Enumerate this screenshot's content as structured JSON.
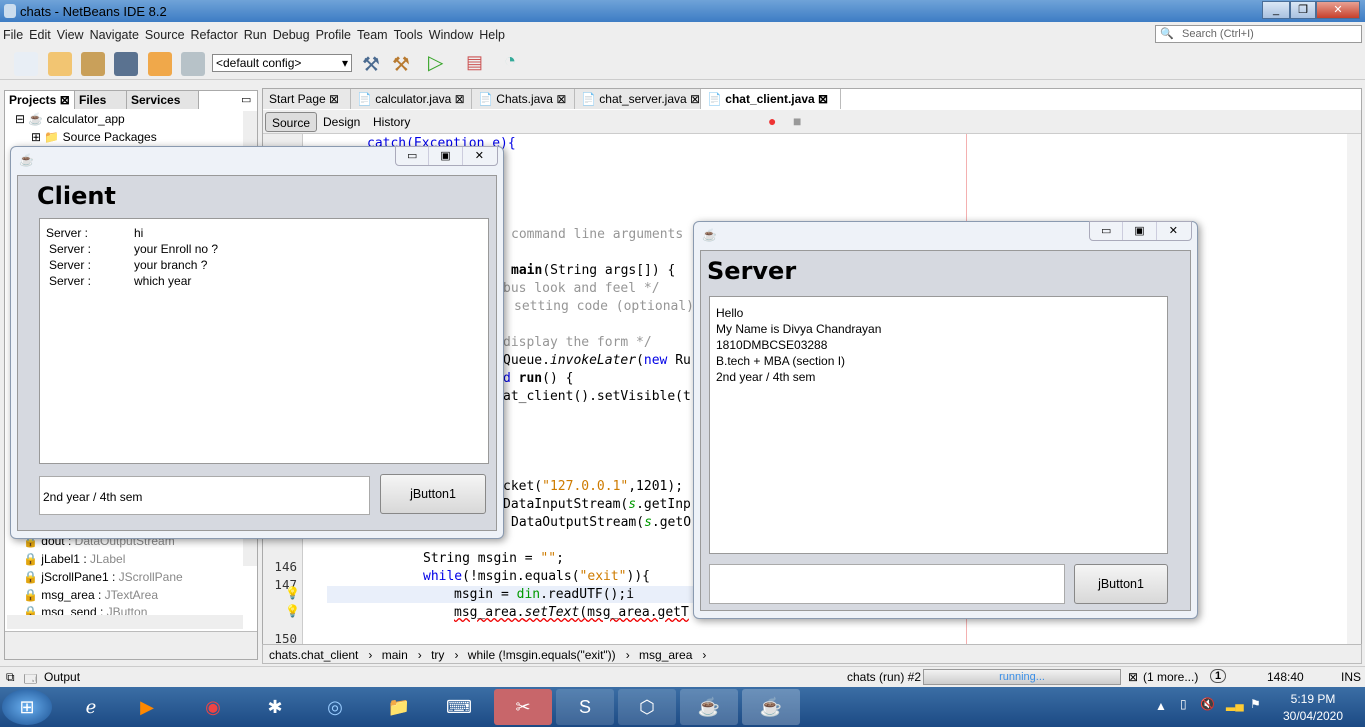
{
  "window": {
    "title": "chats - NetBeans IDE 8.2",
    "controls": [
      "_",
      "❐",
      "✕"
    ]
  },
  "menu": [
    "File",
    "Edit",
    "View",
    "Navigate",
    "Source",
    "Refactor",
    "Run",
    "Debug",
    "Profile",
    "Team",
    "Tools",
    "Window",
    "Help"
  ],
  "search": {
    "placeholder": "Search (Ctrl+I)"
  },
  "toolbar": {
    "config": "<default config>"
  },
  "left_panel": {
    "tabs": [
      "Projects",
      "Files",
      "Services"
    ],
    "tree": [
      {
        "name": "calculator_app",
        "type": ""
      },
      {
        "name": "Source Packages",
        "type": ""
      },
      {
        "name": "dout",
        "type": "DataOutputStream"
      },
      {
        "name": "jLabel1",
        "type": "JLabel"
      },
      {
        "name": "jScrollPane1",
        "type": "JScrollPane"
      },
      {
        "name": "msg_area",
        "type": "JTextArea"
      },
      {
        "name": "msg_send",
        "type": "JButton"
      }
    ]
  },
  "editor": {
    "tabs": [
      "Start Page",
      "calculator.java",
      "Chats.java",
      "chat_server.java",
      "chat_client.java"
    ],
    "view_tabs": [
      "Source",
      "Design",
      "History"
    ],
    "line_numbers": [
      "146",
      "147",
      "150"
    ],
    "code": {
      "l1": "catch(Exception e){",
      "l2": "command line arguments",
      "l3a": "main",
      "l3b": "(String args[]) {",
      "l4": "bus look and feel */",
      "l5": "setting code (optional)",
      "l6": "display the form */",
      "l7a": "Queue.",
      "l7b": "invokeLater",
      "l7c": "(",
      "l7d": "new",
      "l7e": " Ru",
      "l8a": "d ",
      "l8b": "run",
      "l8c": "() {",
      "l9": "at_client().setVisible(t",
      "l10a": "cket(",
      "l10b": "\"127.0.0.1\"",
      "l10c": ",1201);",
      "l11a": "DataInputStream(",
      "l11b": "s",
      "l11c": ".getInp",
      "l12a": "DataOutputStream(",
      "l12b": "s",
      "l12c": ".getO",
      "l13a": "String msgin = ",
      "l13b": "\"\"",
      "l13c": ";",
      "l14a": "while",
      "l14b": "(!msgin.equals(",
      "l14c": "\"exit\"",
      "l14d": ")){",
      "l15a": "msgin = ",
      "l15b": "din",
      "l15c": ".readUTF();i",
      "l16a": "msg_area.",
      "l16b": "setText",
      "l16c": "(msg_area.getT"
    }
  },
  "breadcrumb": [
    "chats.chat_client",
    "main",
    "try",
    "while (!msgin.equals(\"exit\"))",
    "msg_area"
  ],
  "output_label": "Output",
  "status": {
    "task": "chats (run) #2",
    "progress_text": "running...",
    "more": "(1 more...)",
    "notifications": "1",
    "position": "148:40",
    "mode": "INS"
  },
  "clock": {
    "time": "5:19 PM",
    "date": "30/04/2020"
  },
  "client": {
    "heading": "Client",
    "messages": [
      [
        "Server :",
        "hi"
      ],
      [
        "Server :",
        "your Enroll no ?"
      ],
      [
        "Server :",
        "your branch ?"
      ],
      [
        "Server :",
        "which year"
      ]
    ],
    "input": "2nd year / 4th sem",
    "button": "jButton1"
  },
  "server": {
    "heading": "Server",
    "messages": [
      "Hello",
      "My Name is Divya Chandrayan",
      "1810DMBCSE03288",
      "B.tech + MBA (section  I)",
      "2nd year / 4th sem"
    ],
    "input": "",
    "button": "jButton1"
  }
}
